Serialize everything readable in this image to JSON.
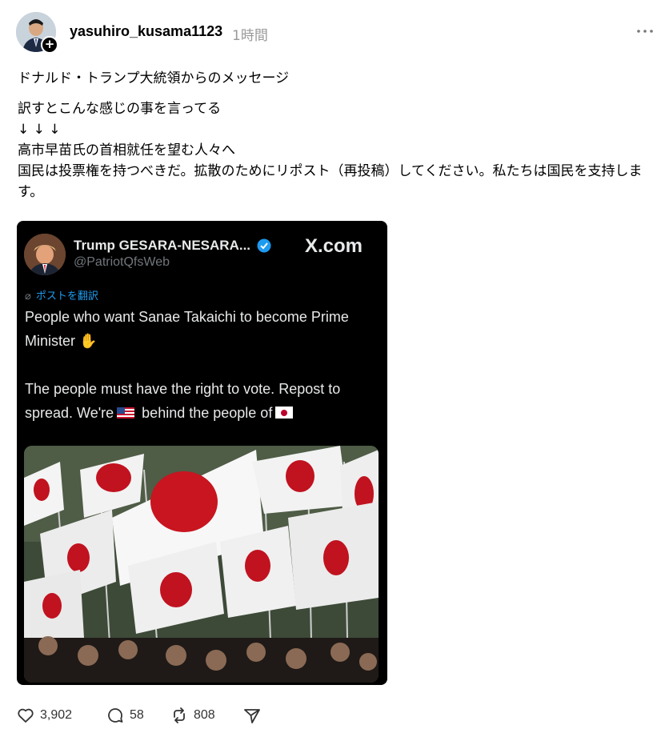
{
  "post": {
    "username": "yasuhiro_kusama1123",
    "timestamp": "1時間",
    "more_icon": "more-horizontal-icon",
    "lines": [
      "ドナルド・トランプ大統領からのメッセージ",
      "訳すとこんな感じの事を言ってる",
      "↓ ↓ ↓",
      "高市早苗氏の首相就任を望む人々へ",
      "国民は投票権を持つべきだ。拡散のためにリポスト（再投稿）してください。私たちは国民を支持します。"
    ]
  },
  "embed": {
    "name": "Trump GESARA-NESARA...",
    "handle": "@PatriotQfsWeb",
    "brand": "X.com",
    "translate_label": "ポストを翻訳",
    "line1": "People who want Sanae Takaichi to become Prime Minister",
    "hand_emoji": "✋",
    "line2_a": "The people must have the right to vote. Repost to spread. We're",
    "line2_b": "behind the people of",
    "verified_color": "#1d9bf0"
  },
  "actions": {
    "likes": "3,902",
    "replies": "58",
    "reposts": "808"
  }
}
